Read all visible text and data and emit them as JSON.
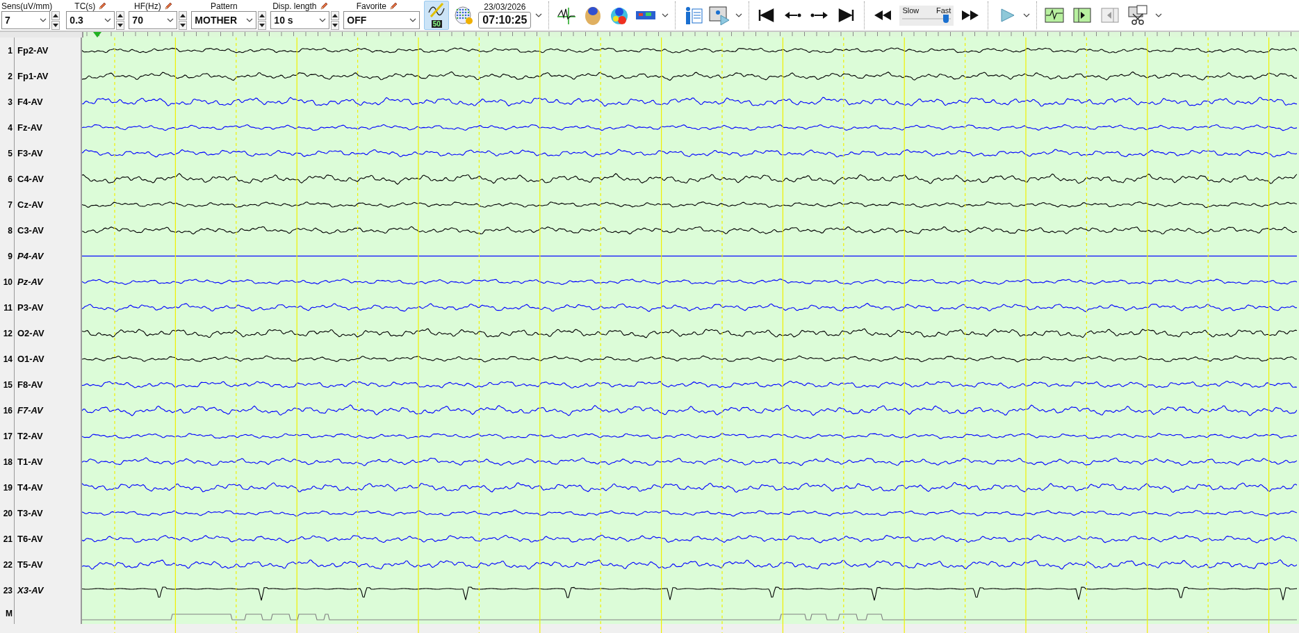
{
  "toolbar": {
    "controls": [
      {
        "label": "Sens(uV/mm)",
        "value": "7",
        "editable": false,
        "spinner": true
      },
      {
        "label": "TC(s)",
        "value": "0.3",
        "editable": true,
        "spinner": true
      },
      {
        "label": "HF(Hz)",
        "value": "70",
        "editable": true,
        "spinner": true
      },
      {
        "label": "Pattern",
        "value": "MOTHER",
        "editable": false,
        "spinner": true
      },
      {
        "label": "Disp. length",
        "value": "10 s",
        "editable": true,
        "spinner": true
      },
      {
        "label": "Favorite",
        "value": "OFF",
        "editable": true,
        "spinner": false
      }
    ],
    "notch_filter": {
      "badge": "50",
      "selected": true
    },
    "date": "23/03/2026",
    "time": "07:10:25",
    "speed": {
      "slow_label": "Slow",
      "fast_label": "Fast",
      "level": 0.9
    }
  },
  "channels": [
    {
      "number": "1",
      "name": "Fp2-AV",
      "italic": false,
      "color": "#000000",
      "kind": "eeg"
    },
    {
      "number": "2",
      "name": "Fp1-AV",
      "italic": false,
      "color": "#000000",
      "kind": "eeg"
    },
    {
      "number": "3",
      "name": "F4-AV",
      "italic": false,
      "color": "#0000ff",
      "kind": "eeg"
    },
    {
      "number": "4",
      "name": "Fz-AV",
      "italic": false,
      "color": "#0000ff",
      "kind": "eeg"
    },
    {
      "number": "5",
      "name": "F3-AV",
      "italic": false,
      "color": "#0000ff",
      "kind": "eeg"
    },
    {
      "number": "6",
      "name": "C4-AV",
      "italic": false,
      "color": "#000000",
      "kind": "eeg"
    },
    {
      "number": "7",
      "name": "Cz-AV",
      "italic": false,
      "color": "#000000",
      "kind": "eeg"
    },
    {
      "number": "8",
      "name": "C3-AV",
      "italic": false,
      "color": "#000000",
      "kind": "eeg"
    },
    {
      "number": "9",
      "name": "P4-AV",
      "italic": true,
      "color": "#0000ff",
      "kind": "flat"
    },
    {
      "number": "10",
      "name": "Pz-AV",
      "italic": true,
      "color": "#0000ff",
      "kind": "eeg"
    },
    {
      "number": "11",
      "name": "P3-AV",
      "italic": false,
      "color": "#0000ff",
      "kind": "eeg"
    },
    {
      "number": "12",
      "name": "O2-AV",
      "italic": false,
      "color": "#000000",
      "kind": "eeg"
    },
    {
      "number": "14",
      "name": "O1-AV",
      "italic": false,
      "color": "#000000",
      "kind": "eeg"
    },
    {
      "number": "15",
      "name": "F8-AV",
      "italic": false,
      "color": "#0000ff",
      "kind": "eeg"
    },
    {
      "number": "16",
      "name": "F7-AV",
      "italic": true,
      "color": "#0000ff",
      "kind": "eeg"
    },
    {
      "number": "17",
      "name": "T2-AV",
      "italic": false,
      "color": "#0000ff",
      "kind": "eeg"
    },
    {
      "number": "18",
      "name": "T1-AV",
      "italic": false,
      "color": "#0000ff",
      "kind": "eeg"
    },
    {
      "number": "19",
      "name": "T4-AV",
      "italic": false,
      "color": "#0000ff",
      "kind": "eeg"
    },
    {
      "number": "20",
      "name": "T3-AV",
      "italic": false,
      "color": "#0000ff",
      "kind": "eeg"
    },
    {
      "number": "21",
      "name": "T6-AV",
      "italic": false,
      "color": "#0000ff",
      "kind": "eeg"
    },
    {
      "number": "22",
      "name": "T5-AV",
      "italic": false,
      "color": "#0000ff",
      "kind": "eeg"
    },
    {
      "number": "23",
      "name": "X3-AV",
      "italic": true,
      "color": "#000000",
      "kind": "ecg"
    },
    {
      "number": "M",
      "color": "#808080",
      "kind": "marker"
    }
  ]
}
